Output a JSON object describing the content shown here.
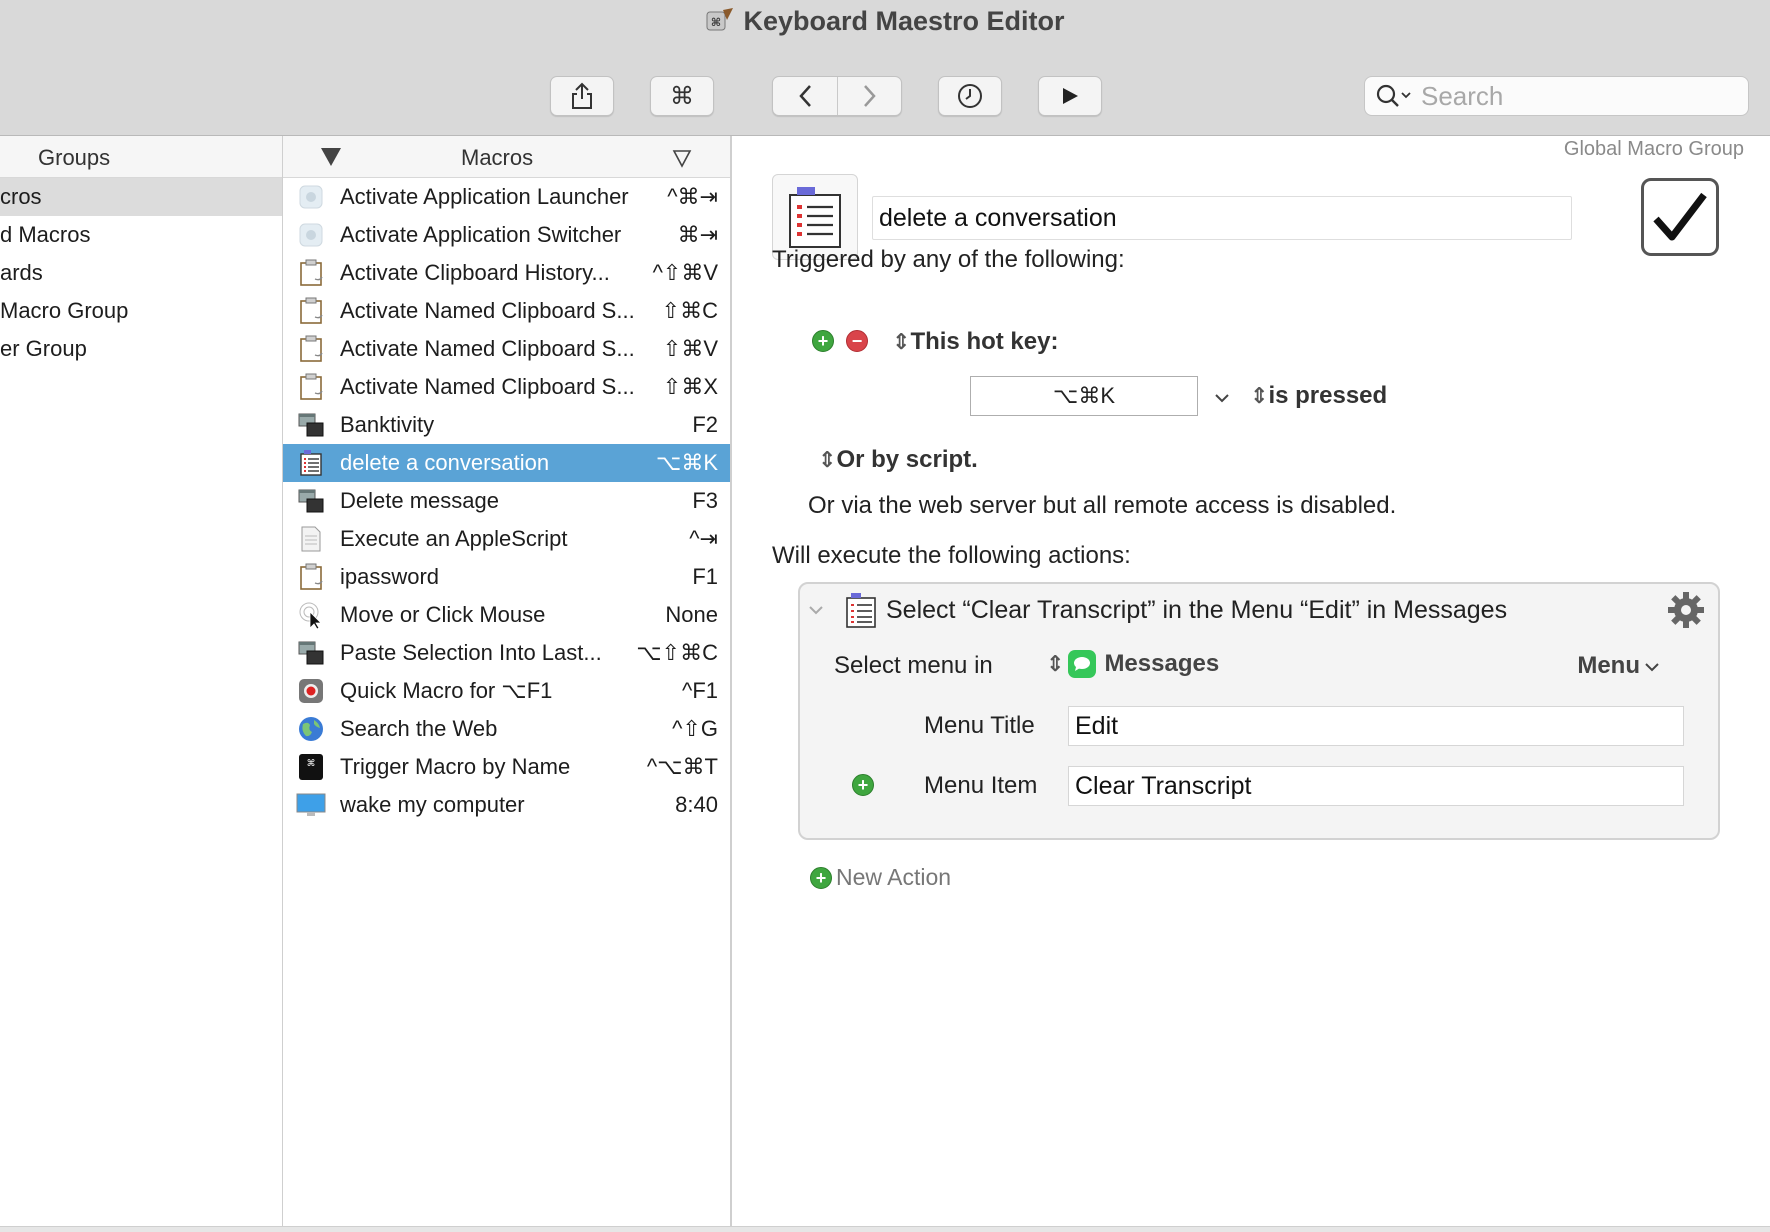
{
  "window": {
    "title": "Keyboard Maestro Editor"
  },
  "toolbar": {
    "share_icon": "share-icon",
    "command_glyph": "⌘",
    "back_icon": "chevron-left-icon",
    "forward_icon": "chevron-right-icon",
    "history_icon": "clock-icon",
    "run_icon": "play-icon",
    "search_placeholder": "Search"
  },
  "groups": {
    "header": "Groups",
    "items": [
      {
        "label": "cros",
        "selected": true
      },
      {
        "label": "d Macros",
        "selected": false
      },
      {
        "label": "ards",
        "selected": false
      },
      {
        "label": "Macro Group",
        "selected": false
      },
      {
        "label": "er Group",
        "selected": false
      }
    ]
  },
  "macros": {
    "header": "Macros",
    "items": [
      {
        "name": "Activate Application Launcher",
        "key": "^⌘⇥",
        "icon": "app-icon",
        "selected": false
      },
      {
        "name": "Activate Application Switcher",
        "key": "⌘⇥",
        "icon": "app-icon",
        "selected": false
      },
      {
        "name": "Activate Clipboard History...",
        "key": "^⇧⌘V",
        "icon": "clipboard-icon",
        "selected": false
      },
      {
        "name": "Activate Named Clipboard S...",
        "key": "⇧⌘C",
        "icon": "clipboard-icon",
        "selected": false
      },
      {
        "name": "Activate Named Clipboard S...",
        "key": "⇧⌘V",
        "icon": "clipboard-icon",
        "selected": false
      },
      {
        "name": "Activate Named Clipboard S...",
        "key": "⇧⌘X",
        "icon": "clipboard-icon",
        "selected": false
      },
      {
        "name": "Banktivity",
        "key": "F2",
        "icon": "windows-icon",
        "selected": false
      },
      {
        "name": "delete a conversation",
        "key": "⌥⌘K",
        "icon": "menu-list-icon",
        "selected": true
      },
      {
        "name": "Delete message",
        "key": "F3",
        "icon": "windows-icon",
        "selected": false
      },
      {
        "name": "Execute an AppleScript",
        "key": "^⇥",
        "icon": "script-icon",
        "selected": false
      },
      {
        "name": "ipassword",
        "key": "F1",
        "icon": "clipboard-icon",
        "selected": false
      },
      {
        "name": "Move or Click Mouse",
        "key": "None",
        "icon": "mouse-pointer-icon",
        "selected": false
      },
      {
        "name": "Paste Selection Into Last...",
        "key": "⌥⇧⌘C",
        "icon": "windows-icon",
        "selected": false
      },
      {
        "name": "Quick Macro for ⌥F1",
        "key": "^F1",
        "icon": "record-icon",
        "selected": false
      },
      {
        "name": "Search the Web",
        "key": "^⇧G",
        "icon": "globe-icon",
        "selected": false
      },
      {
        "name": "Trigger Macro by Name",
        "key": "^⌥⌘T",
        "icon": "command-key-icon",
        "selected": false
      },
      {
        "name": "wake my computer",
        "key": "8:40",
        "icon": "monitor-icon",
        "selected": false
      }
    ]
  },
  "editor": {
    "group_name": "Global Macro Group",
    "macro_name": "delete a conversation",
    "triggered_label": "Triggered by any of the following:",
    "hotkey_trigger_label": "This hot key:",
    "hotkey_value": "⌥⌘K",
    "is_pressed_label": "is pressed",
    "script_label": "Or by script.",
    "web_server_text": "Or via the web server but all remote access is disabled.",
    "execute_label": "Will execute the following actions:",
    "action": {
      "title": "Select “Clear Transcript” in the Menu “Edit” in Messages",
      "select_menu_label": "Select menu in",
      "app_name": "Messages",
      "menu_dropdown": "Menu",
      "menu_title_label": "Menu Title",
      "menu_title_value": "Edit",
      "menu_item_label": "Menu Item",
      "menu_item_value": "Clear Transcript"
    },
    "new_action_label": "New Action"
  },
  "colors": {
    "selection": "#5aa3d6",
    "add_green": "#3fa63f",
    "remove_red": "#d9444a",
    "messages_green": "#35c759"
  }
}
